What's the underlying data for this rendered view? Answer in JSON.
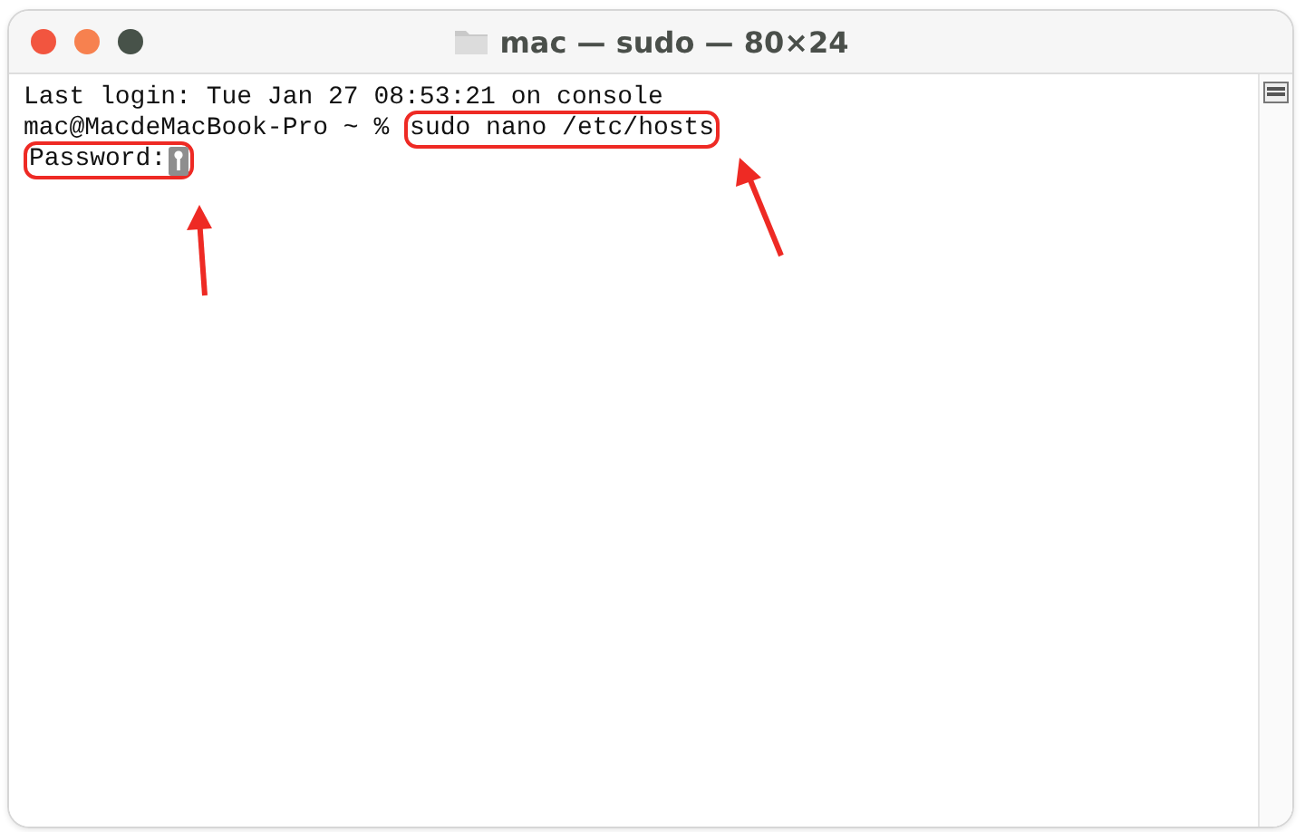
{
  "window": {
    "title": "mac — sudo — 80×24"
  },
  "lines": [
    {
      "segments": [
        {
          "text": "Last login: Tue Jan 27 08:53:21 on console",
          "highlighted": false
        }
      ]
    },
    {
      "segments": [
        {
          "text": "mac@MacdeMacBook-Pro ~ % ",
          "highlighted": false
        },
        {
          "text": "sudo nano /etc/hosts",
          "highlighted": true
        }
      ]
    },
    {
      "segments": [
        {
          "text": "Password:",
          "highlighted": true,
          "key_icon": true
        }
      ]
    }
  ]
}
